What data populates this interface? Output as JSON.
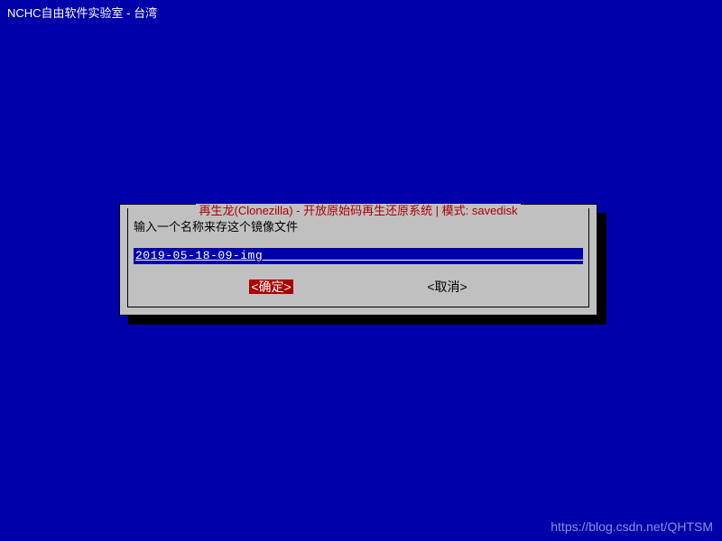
{
  "header": {
    "title": "NCHC自由软件实验室 - 台湾"
  },
  "dialog": {
    "title": "再生龙(Clonezilla) - 开放原始码再生还原系统 | 模式: savedisk",
    "prompt": "输入一个名称来存这个镜像文件",
    "input_value": "2019-05-18-09-img",
    "ok_label": "确定",
    "cancel_label": "取消"
  },
  "watermark": "https://blog.csdn.net/QHTSM"
}
